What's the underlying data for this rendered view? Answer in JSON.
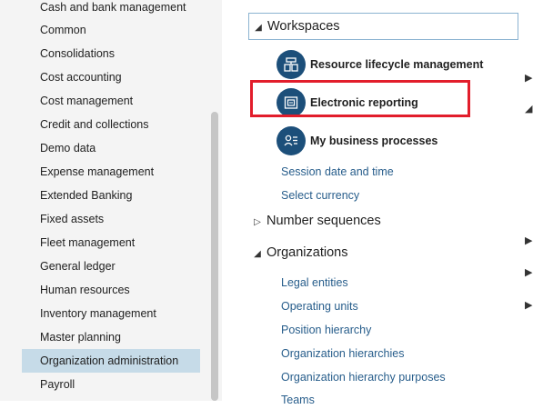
{
  "nav": {
    "items": [
      {
        "label": "Cash and bank management"
      },
      {
        "label": "Common"
      },
      {
        "label": "Consolidations"
      },
      {
        "label": "Cost accounting"
      },
      {
        "label": "Cost management"
      },
      {
        "label": "Credit and collections"
      },
      {
        "label": "Demo data"
      },
      {
        "label": "Expense management"
      },
      {
        "label": "Extended Banking"
      },
      {
        "label": "Fixed assets"
      },
      {
        "label": "Fleet management"
      },
      {
        "label": "General ledger"
      },
      {
        "label": "Human resources"
      },
      {
        "label": "Inventory management"
      },
      {
        "label": "Master planning"
      },
      {
        "label": "Organization administration"
      },
      {
        "label": "Payroll"
      }
    ],
    "selected": "Organization administration"
  },
  "workspaces": {
    "title": "Workspaces",
    "tiles": [
      {
        "label": "Resource lifecycle management",
        "icon": "resource-lifecycle-icon"
      },
      {
        "label": "Electronic reporting",
        "icon": "electronic-reporting-icon"
      },
      {
        "label": "My business processes",
        "icon": "business-processes-icon"
      }
    ],
    "links": [
      {
        "label": "Session date and time"
      },
      {
        "label": "Select currency"
      }
    ]
  },
  "number_sequences": {
    "title": "Number sequences"
  },
  "organizations": {
    "title": "Organizations",
    "links": [
      {
        "label": "Legal entities"
      },
      {
        "label": "Operating units"
      },
      {
        "label": "Position hierarchy"
      },
      {
        "label": "Organization hierarchies"
      },
      {
        "label": "Organization hierarchy purposes"
      },
      {
        "label": "Teams"
      }
    ]
  },
  "colors": {
    "highlight": "#e21d2b",
    "selected_nav": "#c6dbe8",
    "link": "#275d8b",
    "tile_icon": "#1c4f7a"
  }
}
